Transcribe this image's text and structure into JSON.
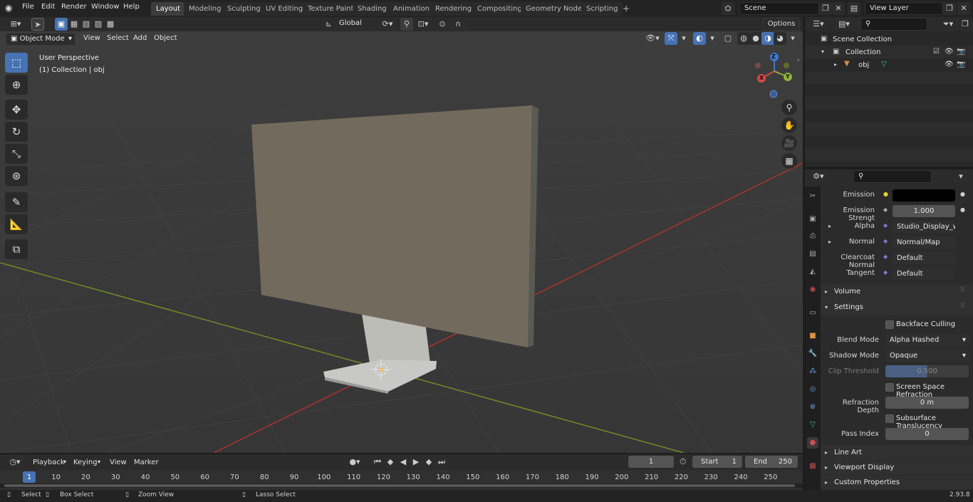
{
  "topbar": {
    "menus": [
      "File",
      "Edit",
      "Render",
      "Window",
      "Help"
    ],
    "workspace_tabs": [
      "Layout",
      "Modeling",
      "Sculpting",
      "UV Editing",
      "Texture Paint",
      "Shading",
      "Animation",
      "Rendering",
      "Compositing",
      "Geometry Nodes",
      "Scripting"
    ],
    "add_tab": "+",
    "scene_name": "Scene",
    "view_layer": "View Layer"
  },
  "tool_header": {
    "transform_orientation": "Global",
    "options": "Options"
  },
  "viewport_header": {
    "mode": "Object Mode",
    "menus": [
      "View",
      "Select",
      "Add",
      "Object"
    ]
  },
  "viewport": {
    "perspective_label": "User Perspective",
    "collection_label": "(1) Collection | obj",
    "gizmo": {
      "x": "X",
      "y": "Y",
      "z": "Z"
    }
  },
  "outliner": {
    "root": "Scene Collection",
    "collection": "Collection",
    "object": "obj"
  },
  "properties": {
    "rows": [
      {
        "label": "Emission",
        "value": ""
      },
      {
        "label": "Emission Strengt",
        "value": "1.000"
      },
      {
        "label": "Alpha",
        "value": "Studio_Display_with..."
      },
      {
        "label": "Normal",
        "value": "Normal/Map"
      },
      {
        "label": "Clearcoat Normal",
        "value": "Default"
      },
      {
        "label": "Tangent",
        "value": "Default"
      }
    ],
    "volume_panel": "Volume",
    "settings_panel": "Settings",
    "backface_culling": "Backface Culling",
    "blend_mode_label": "Blend Mode",
    "blend_mode_value": "Alpha Hashed",
    "shadow_mode_label": "Shadow Mode",
    "shadow_mode_value": "Opaque",
    "clip_threshold_label": "Clip Threshold",
    "clip_threshold_value": "0.500",
    "screen_space_refraction": "Screen Space Refraction",
    "refraction_depth_label": "Refraction Depth",
    "refraction_depth_value": "0 m",
    "subsurface_translucency": "Subsurface Translucency",
    "pass_index_label": "Pass Index",
    "pass_index_value": "0",
    "line_art_panel": "Line Art",
    "viewport_display_panel": "Viewport Display",
    "custom_properties_panel": "Custom Properties"
  },
  "timeline": {
    "menus": [
      "Playback",
      "Keying",
      "View",
      "Marker"
    ],
    "current_frame": "1",
    "start_label": "Start",
    "start_value": "1",
    "end_label": "End",
    "end_value": "250",
    "ticks": [
      "1",
      "10",
      "20",
      "30",
      "40",
      "50",
      "60",
      "70",
      "80",
      "90",
      "100",
      "110",
      "120",
      "130",
      "140",
      "150",
      "160",
      "170",
      "180",
      "190",
      "200",
      "210",
      "220",
      "230",
      "240",
      "250"
    ]
  },
  "statusbar": {
    "select": "Select",
    "box_select": "Box Select",
    "zoom_view": "Zoom View",
    "lasso_select": "Lasso Select",
    "version": "2.93.8"
  },
  "colors": {
    "accent": "#4772b3",
    "viewport_bg": "#393939",
    "x_axis": "#c03a3a",
    "y_axis": "#7a9a2a"
  }
}
